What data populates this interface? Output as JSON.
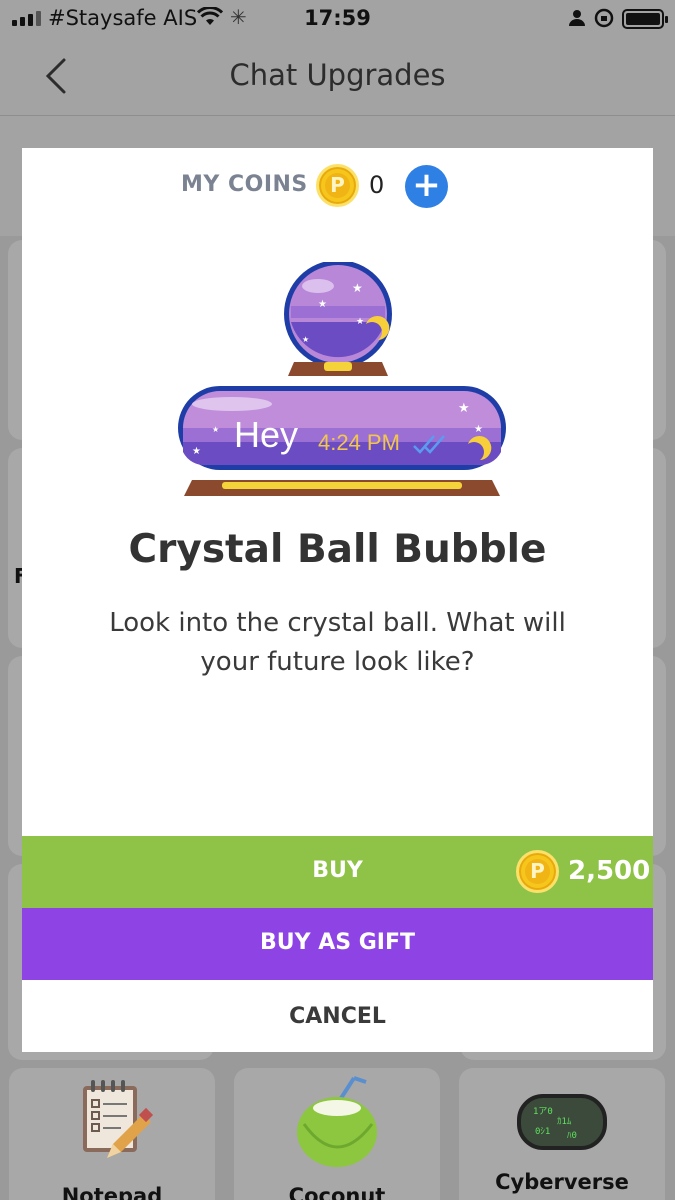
{
  "status_bar": {
    "carrier": "#Staysafe AIS",
    "time": "17:59"
  },
  "nav": {
    "title": "Chat Upgrades",
    "back_icon": "chevron-left-icon"
  },
  "background_tiles": [
    {
      "label": "Notepad",
      "icon": "notepad-icon"
    },
    {
      "label": "Coconut",
      "icon": "coconut-icon"
    },
    {
      "label": "Cyberverse",
      "icon": "cyberverse-icon"
    }
  ],
  "background_edge_letter": "F",
  "modal": {
    "coins_label": "MY COINS",
    "coin_symbol": "P",
    "coin_count": "0",
    "preview": {
      "message": "Hey",
      "timestamp": "4:24 PM"
    },
    "title": "Crystal Ball Bubble",
    "description": "Look into the crystal ball. What will your future look like?",
    "buy_label": "BUY",
    "price": "2,500",
    "gift_label": "BUY AS GIFT",
    "cancel_label": "CANCEL"
  },
  "colors": {
    "buy": "#8fc347",
    "gift": "#8e44e4",
    "add": "#2f80e4",
    "coin": "#f6c61d",
    "overlay": "#9a9a9a"
  }
}
